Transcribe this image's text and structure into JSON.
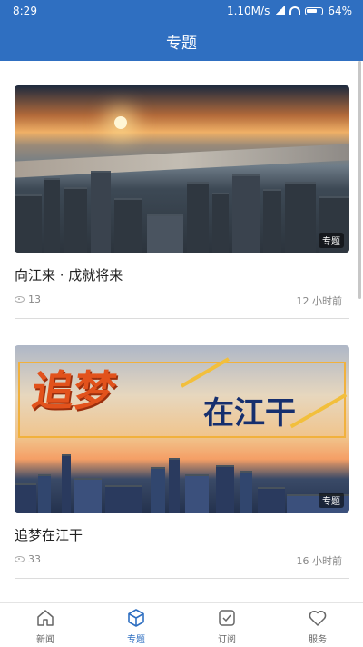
{
  "status_bar": {
    "time": "8:29",
    "network_speed": "1.10M/s",
    "battery": "64%"
  },
  "header": {
    "title": "专题"
  },
  "articles": [
    {
      "title": "向江来 · 成就将来",
      "views": "13",
      "time": "12 小时前",
      "tag": "专题"
    },
    {
      "title": "追梦在江干",
      "views": "33",
      "time": "16 小时前",
      "tag": "专题",
      "banner_text_1": "追梦",
      "banner_text_2": "在江干"
    }
  ],
  "tabbar": {
    "items": [
      {
        "label": "新闻",
        "icon": "home-icon"
      },
      {
        "label": "专题",
        "icon": "cube-icon",
        "active": true
      },
      {
        "label": "订阅",
        "icon": "checkbox-icon"
      },
      {
        "label": "服务",
        "icon": "heart-icon"
      }
    ]
  },
  "colors": {
    "primary": "#2f6fc1",
    "text": "#222222",
    "muted": "#888888"
  }
}
